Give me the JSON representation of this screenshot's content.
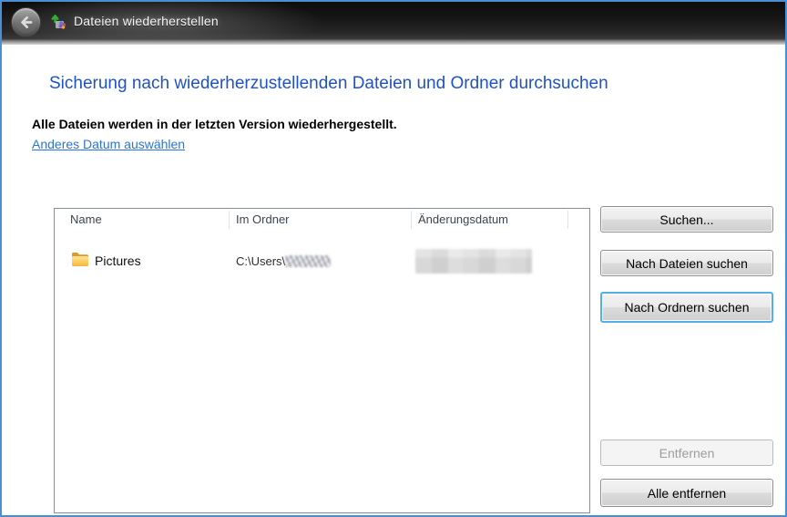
{
  "window": {
    "title": "Dateien wiederherstellen"
  },
  "page": {
    "heading": "Sicherung nach wiederherzustellenden Dateien und Ordner durchsuchen",
    "description": "Alle Dateien werden in der letzten Version wiederhergestellt.",
    "change_date_link": "Anderes Datum auswählen"
  },
  "file_list": {
    "columns": [
      "Name",
      "Im Ordner",
      "Änderungsdatum"
    ],
    "rows": [
      {
        "name": "Pictures",
        "icon": "folder-icon",
        "folder_path_prefix": "C:\\Users\\",
        "folder_path_user_redacted": true,
        "modified_date_redacted": true
      }
    ]
  },
  "actions": {
    "search": "Suchen...",
    "search_files": "Nach Dateien suchen",
    "search_folders": "Nach Ordnern suchen",
    "remove": "Entfernen",
    "remove_all": "Alle entfernen"
  },
  "colors": {
    "window_border": "#4a8fd2",
    "heading": "#2052c2",
    "link": "#2b74d6",
    "focus_border": "#54b0e2"
  }
}
